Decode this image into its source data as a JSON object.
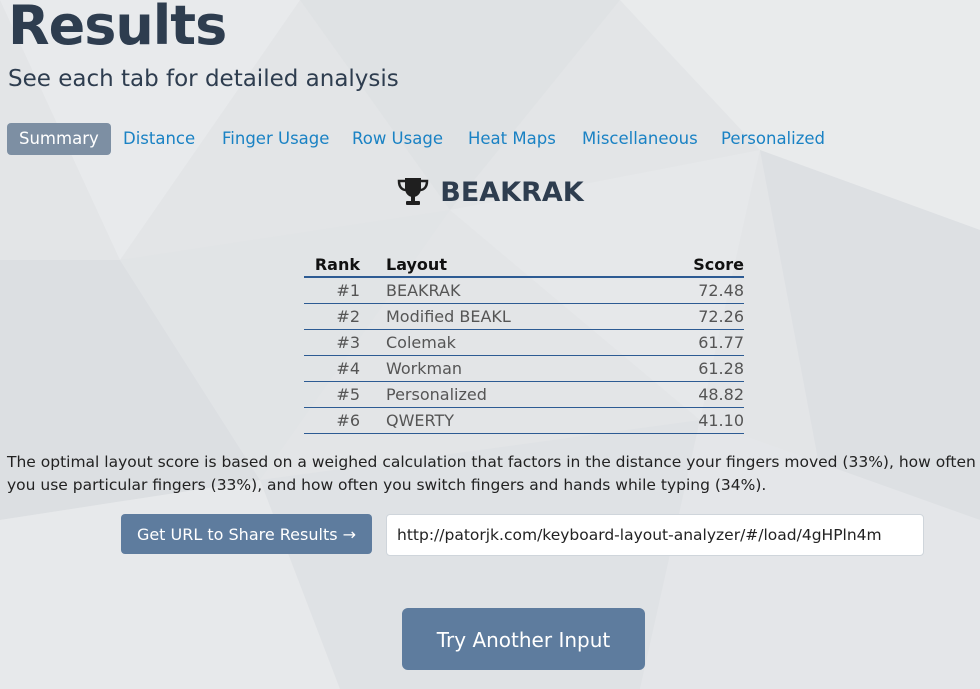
{
  "header": {
    "title": "Results",
    "subtitle": "See each tab for detailed analysis"
  },
  "tabs": [
    {
      "label": "Summary",
      "active": true
    },
    {
      "label": "Distance"
    },
    {
      "label": "Finger Usage"
    },
    {
      "label": "Row Usage"
    },
    {
      "label": "Heat Maps"
    },
    {
      "label": "Miscellaneous"
    },
    {
      "label": "Personalized"
    }
  ],
  "summary": {
    "winner_icon": "trophy-icon",
    "winner": "BEAKRAK",
    "columns": [
      "Rank",
      "Layout",
      "Score"
    ],
    "rows": [
      {
        "rank": "#1",
        "layout": "BEAKRAK",
        "score": "72.48"
      },
      {
        "rank": "#2",
        "layout": "Modified BEAKL",
        "score": "72.26"
      },
      {
        "rank": "#3",
        "layout": "Colemak",
        "score": "61.77"
      },
      {
        "rank": "#4",
        "layout": "Workman",
        "score": "61.28"
      },
      {
        "rank": "#5",
        "layout": "Personalized",
        "score": "48.82"
      },
      {
        "rank": "#6",
        "layout": "QWERTY",
        "score": "41.10"
      }
    ],
    "description": "The optimal layout score is based on a weighed calculation that factors in the distance your fingers moved (33%), how often you use particular fingers (33%), and how often you switch fingers and hands while typing (34%)."
  },
  "share": {
    "button_label": "Get URL to Share Results →",
    "url": "http://patorjk.com/keyboard-layout-analyzer/#/load/4gHPln4m"
  },
  "actions": {
    "try_another_label": "Try Another Input"
  },
  "colors": {
    "tab_link": "#1a82c4",
    "tab_active_bg": "#7d8fa3",
    "button_bg": "#5e7c9e",
    "table_rule": "#2d5b93",
    "heading": "#2e3d4f"
  }
}
